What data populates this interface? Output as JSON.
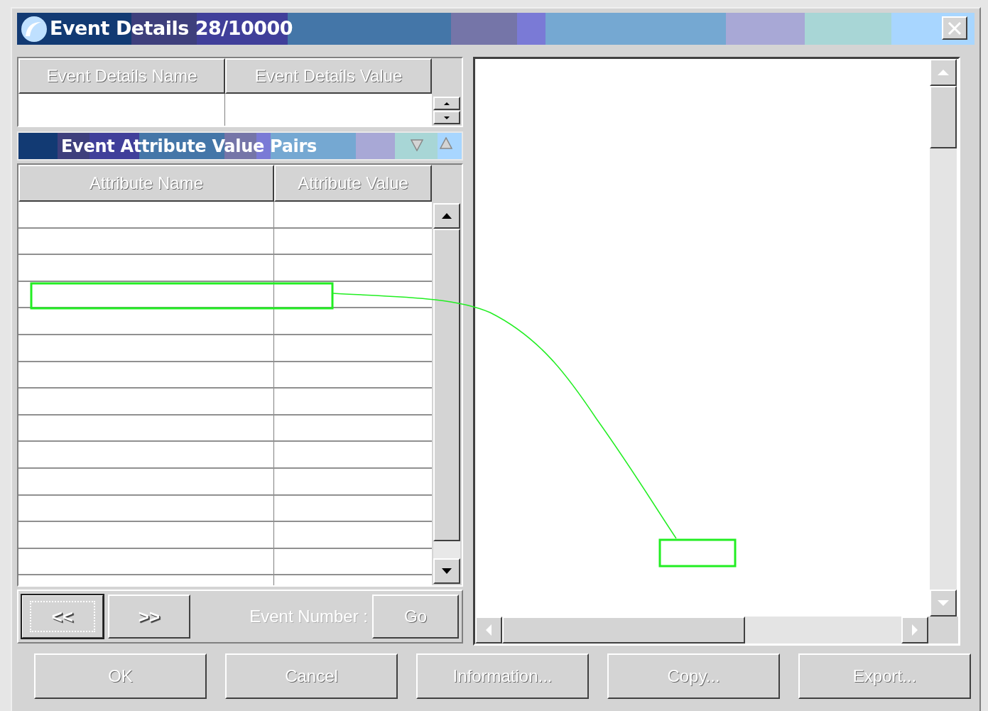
{
  "window": {
    "title": "Event Details 28/10000"
  },
  "details_table": {
    "columns": [
      "Event Details Name",
      "Event Details Value"
    ]
  },
  "attribute_section": {
    "title": "Event Attribute Value Pairs"
  },
  "attribute_table": {
    "columns": [
      "Attribute Name",
      "Attribute Value"
    ]
  },
  "navigation": {
    "buttons": [
      {
        "label": "<<",
        "disabled": true,
        "focused": true
      },
      {
        "label": ">>",
        "disabled": true,
        "focused": false
      }
    ],
    "event_number_label": "Event Number :",
    "go_button": {
      "label": "Go",
      "disabled": true
    }
  },
  "buttons": [
    {
      "label": "OK",
      "disabled": true
    },
    {
      "label": "Cancel",
      "disabled": true
    },
    {
      "label": "Information...",
      "disabled": true
    },
    {
      "label": "Copy...",
      "disabled": true
    },
    {
      "label": "Export...",
      "disabled": true
    }
  ]
}
